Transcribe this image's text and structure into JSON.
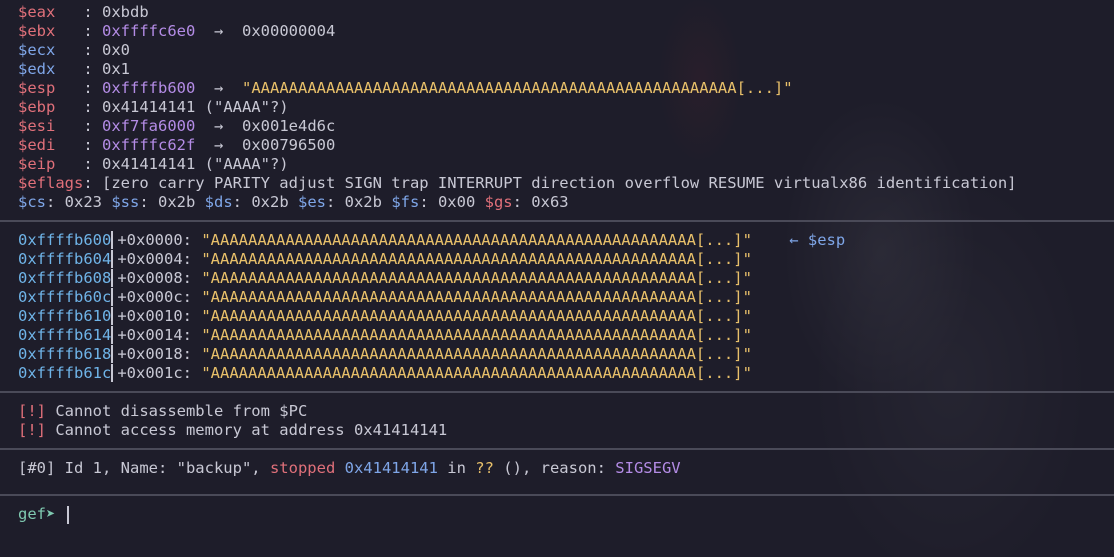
{
  "registers": [
    {
      "name": "$eax",
      "sep": "   : ",
      "value": "0xbdb",
      "arrow": "",
      "target": ""
    },
    {
      "name": "$ebx",
      "sep": "   : ",
      "value": "0xffffc6e0",
      "arrow": "  →  ",
      "target": "0x00000004"
    },
    {
      "name": "$ecx",
      "sep": "   : ",
      "value": "0x0",
      "arrow": "",
      "target": ""
    },
    {
      "name": "$edx",
      "sep": "   : ",
      "value": "0x1",
      "arrow": "",
      "target": ""
    },
    {
      "name": "$esp",
      "sep": "   : ",
      "value": "0xffffb600",
      "arrow": "  →  ",
      "target": "\"AAAAAAAAAAAAAAAAAAAAAAAAAAAAAAAAAAAAAAAAAAAAAAAAAAAA[...]\""
    },
    {
      "name": "$ebp",
      "sep": "   : ",
      "value": "0x41414141 (\"AAAA\"?)",
      "arrow": "",
      "target": ""
    },
    {
      "name": "$esi",
      "sep": "   : ",
      "value": "0xf7fa6000",
      "arrow": "  →  ",
      "target": "0x001e4d6c"
    },
    {
      "name": "$edi",
      "sep": "   : ",
      "value": "0xffffc62f",
      "arrow": "  →  ",
      "target": "0x00796500"
    },
    {
      "name": "$eip",
      "sep": "   : ",
      "value": "0x41414141 (\"AAAA\"?)",
      "arrow": "",
      "target": ""
    }
  ],
  "eflags": {
    "name": "$eflags",
    "text": ": [zero carry PARITY adjust SIGN trap INTERRUPT direction overflow RESUME virtualx86 identification]"
  },
  "segments": [
    {
      "name": "$cs",
      "value": ": 0x23 "
    },
    {
      "name": "$ss",
      "value": ": 0x2b "
    },
    {
      "name": "$ds",
      "value": ": 0x2b "
    },
    {
      "name": "$es",
      "value": ": 0x2b "
    },
    {
      "name": "$fs",
      "value": ": 0x00 "
    },
    {
      "name": "$gs",
      "value": ": 0x63"
    }
  ],
  "stack": [
    {
      "addr": "0xffffb600",
      "offset": "+0x0000: ",
      "str": "\"AAAAAAAAAAAAAAAAAAAAAAAAAAAAAAAAAAAAAAAAAAAAAAAAAAAA[...]\"",
      "tag": "    ← $esp"
    },
    {
      "addr": "0xffffb604",
      "offset": "+0x0004: ",
      "str": "\"AAAAAAAAAAAAAAAAAAAAAAAAAAAAAAAAAAAAAAAAAAAAAAAAAAAA[...]\"",
      "tag": ""
    },
    {
      "addr": "0xffffb608",
      "offset": "+0x0008: ",
      "str": "\"AAAAAAAAAAAAAAAAAAAAAAAAAAAAAAAAAAAAAAAAAAAAAAAAAAAA[...]\"",
      "tag": ""
    },
    {
      "addr": "0xffffb60c",
      "offset": "+0x000c: ",
      "str": "\"AAAAAAAAAAAAAAAAAAAAAAAAAAAAAAAAAAAAAAAAAAAAAAAAAAAA[...]\"",
      "tag": ""
    },
    {
      "addr": "0xffffb610",
      "offset": "+0x0010: ",
      "str": "\"AAAAAAAAAAAAAAAAAAAAAAAAAAAAAAAAAAAAAAAAAAAAAAAAAAAA[...]\"",
      "tag": ""
    },
    {
      "addr": "0xffffb614",
      "offset": "+0x0014: ",
      "str": "\"AAAAAAAAAAAAAAAAAAAAAAAAAAAAAAAAAAAAAAAAAAAAAAAAAAAA[...]\"",
      "tag": ""
    },
    {
      "addr": "0xffffb618",
      "offset": "+0x0018: ",
      "str": "\"AAAAAAAAAAAAAAAAAAAAAAAAAAAAAAAAAAAAAAAAAAAAAAAAAAAA[...]\"",
      "tag": ""
    },
    {
      "addr": "0xffffb61c",
      "offset": "+0x001c: ",
      "str": "\"AAAAAAAAAAAAAAAAAAAAAAAAAAAAAAAAAAAAAAAAAAAAAAAAAAAA[...]\"",
      "tag": ""
    }
  ],
  "errors": [
    {
      "mark": "[!]",
      "text": " Cannot disassemble from $PC"
    },
    {
      "mark": "[!]",
      "text": " Cannot access memory at address 0x41414141"
    }
  ],
  "thread": {
    "prefix": "[#0] Id 1, Name: \"backup\", ",
    "stopped": "stopped",
    "addr": " 0x41414141",
    "in": " in ",
    "qq": "??",
    "mid": " (), reason: ",
    "reason": "SIGSEGV"
  },
  "prompt": {
    "label": "gef➤"
  },
  "colors": {
    "background": "#1e1d2a",
    "register": "#e0707a",
    "address": "#b48ce6",
    "string": "#e8c06a",
    "stack_address": "#6fb4e8",
    "prompt": "#7fc9b0"
  }
}
